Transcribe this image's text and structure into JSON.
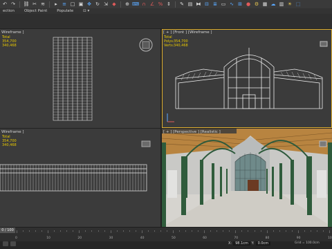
{
  "menu": {
    "items": [
      "ection",
      "Object Paint",
      "Populate"
    ]
  },
  "viewports": {
    "top_left": {
      "label": "Wireframe ]"
    },
    "top_right": {
      "label": "[ + ] [Front ] [Wireframe ]",
      "stats": {
        "title": "Total",
        "polys_label": "Polys:",
        "polys": "354,700",
        "verts_label": "Verts:",
        "verts": "340,468"
      }
    },
    "top_left_stats": {
      "title": "Total",
      "line1": "354,700",
      "line2": "340,468"
    },
    "bottom_left": {
      "label": "Wireframe ]",
      "stats": {
        "title": "Total",
        "line1": "354,700",
        "line2": "340,468"
      }
    },
    "bottom_right": {
      "label": "[ + ] [Perspective ] [Realistic ]"
    }
  },
  "timeline": {
    "frame": "0 / 100",
    "tick_numbers": [
      "0",
      "10",
      "20",
      "30",
      "40",
      "50",
      "60",
      "70",
      "80",
      "90",
      "100"
    ]
  },
  "status": {
    "x_value": "98.1cm",
    "y_value": "0.0cm",
    "z_value": "86.6cm",
    "grid": "Grid = 100.0cm"
  },
  "icons": {
    "toolbar": [
      "undo-icon",
      "redo-icon",
      "link-icon",
      "unlink-icon",
      "bind-icon",
      "selection-filter",
      "select-icon",
      "select-by-name-icon",
      "rect-select-icon",
      "window-crossing-icon",
      "move-icon",
      "rotate-icon",
      "scale-icon",
      "reference-coord",
      "pivot-icon",
      "snap-icon",
      "angle-snap-icon",
      "percent-snap-icon",
      "spinner-snap-icon",
      "named-selection",
      "mirror-icon",
      "align-icon",
      "layer-icon",
      "curve-editor-icon",
      "schematic-icon",
      "material-editor-icon",
      "render-setup-icon",
      "render-frame-icon",
      "render-icon"
    ]
  }
}
